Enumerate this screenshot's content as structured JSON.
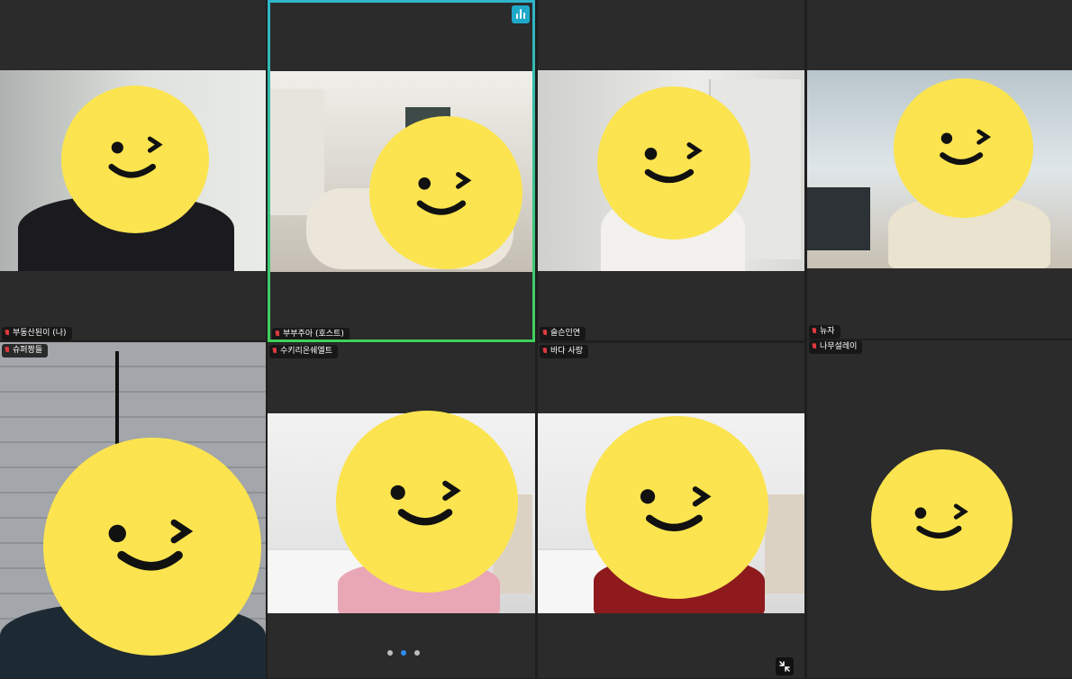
{
  "participants": [
    {
      "name": "부동산된이 (나)"
    },
    {
      "name": "부부주아 (호스트)"
    },
    {
      "name": "슬슨인연"
    },
    {
      "name": "뉴자"
    },
    {
      "name": "슈퍼짱들"
    },
    {
      "name": "수키리온쉐엘트"
    },
    {
      "name": "바다 사랑"
    },
    {
      "name": "나무설레이"
    }
  ],
  "active_speaker": "부부주아 (호스트)",
  "pagination": {
    "pages": 3,
    "current": 2
  },
  "colors": {
    "active_border_top": "#2fb5c9",
    "active_border_bottom": "#3fd15a",
    "smiley": "#fbe44f",
    "tile_bg": "#2b2b2b",
    "muted_mic": "#e0393e",
    "page_dot_active": "#2d8cf0"
  },
  "icons": {
    "mic": "mic-muted-icon",
    "audio": "audio-wave-icon",
    "collapse": "collapse-arrows-icon"
  }
}
